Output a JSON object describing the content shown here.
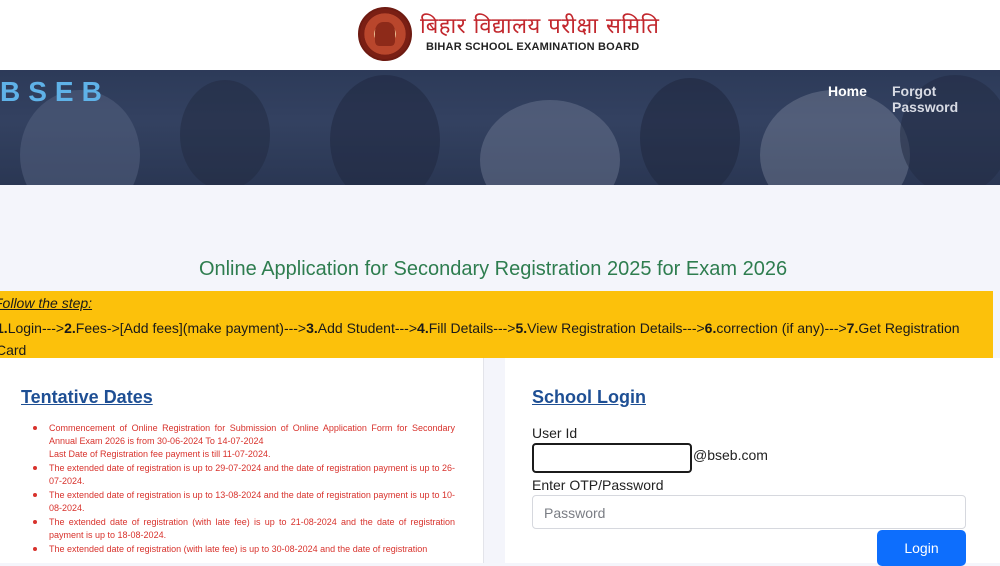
{
  "header": {
    "logo_hindi": "बिहार विद्यालय परीक्षा समिति",
    "logo_english": "BIHAR SCHOOL EXAMINATION BOARD"
  },
  "navbar": {
    "brand": "BSEB",
    "home": "Home",
    "forgot_password": "Forgot Password"
  },
  "main": {
    "title": "Online Application for Secondary Registration 2025 for Exam 2026"
  },
  "steps": {
    "follow_label": "Follow the step:",
    "items": [
      {
        "num": "1.",
        "text": "Login--->"
      },
      {
        "num": "2.",
        "text": "Fees->[Add fees](make payment)--->"
      },
      {
        "num": "3.",
        "text": "Add Student--->"
      },
      {
        "num": "4.",
        "text": "Fill Details--->"
      },
      {
        "num": "5.",
        "text": "View Registration Details--->"
      },
      {
        "num": "6.",
        "text": "correction (if any)--->"
      },
      {
        "num": "7.",
        "text": "Get Registration Card"
      }
    ]
  },
  "tentative_dates": {
    "title": "Tentative Dates",
    "items": [
      {
        "text": "Commencement of Online Registration for Submission of Online Application Form for Secondary Annual Exam 2026 is from 30-06-2024 To 14-07-2024",
        "sub": "Last Date of Registration fee payment is till 11-07-2024."
      },
      {
        "text": "The extended date of registration is up to 29-07-2024 and the date of registration payment is up to 26-07-2024."
      },
      {
        "text": "The extended date of registration is up to 13-08-2024 and the date of registration payment is up to 10-08-2024."
      },
      {
        "text": "The extended date of registration (with late fee) is up to 21-08-2024 and the date of registration payment is up to 18-08-2024."
      },
      {
        "text": "The extended date of registration (with late fee) is up to 30-08-2024 and the date of registration"
      }
    ]
  },
  "school_login": {
    "title": "School Login",
    "user_id_label": "User Id",
    "user_id_value": "",
    "domain_suffix": "@bseb.com",
    "password_label": "Enter OTP/Password",
    "password_placeholder": "Password",
    "login_button": "Login"
  },
  "colors": {
    "title_green": "#2e7d4f",
    "steps_yellow": "#fcc10b",
    "link_blue": "#1e4f94",
    "dates_red": "#d8322c",
    "button_blue": "#0d6efd",
    "brand_blue": "#5fb2e8"
  }
}
